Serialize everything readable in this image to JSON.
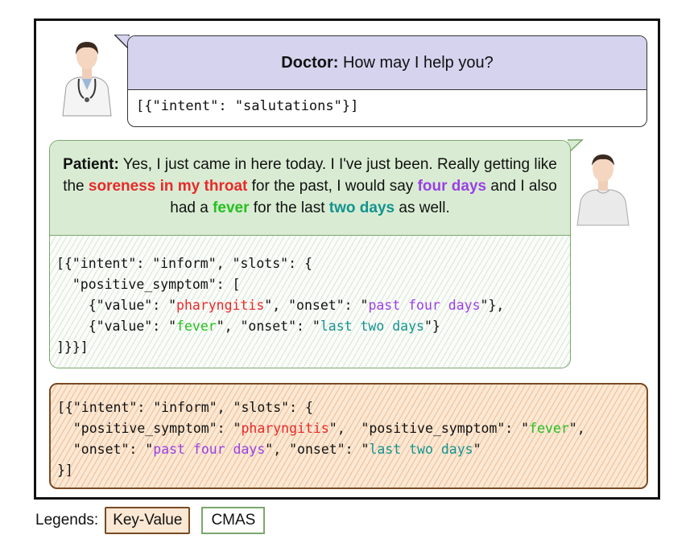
{
  "doctor": {
    "speaker": "Doctor:",
    "utterance": "How may I help you?",
    "annotation": "[{\"intent\": \"salutations\"}]"
  },
  "patient": {
    "speaker": "Patient:",
    "utterance": {
      "p1": "Yes, I just came in here today. I I've just been. Really getting like the",
      "h1": "soreness in my throat",
      "p2": "for the past, I would say",
      "h2": "four days",
      "p3": "and I also had a",
      "h3": "fever",
      "p4": "for the last",
      "h4": "two days",
      "p5": "as well."
    },
    "annotation": {
      "l1": "[{\"intent\": \"inform\", \"slots\": {",
      "l2": "  \"positive_symptom\": [",
      "l3a": "    {\"value\": \"",
      "l3v": "pharyngitis",
      "l3b": "\", \"onset\": \"",
      "l3o": "past four days",
      "l3c": "\"},",
      "l4a": "    {\"value\": \"",
      "l4v": "fever",
      "l4b": "\", \"onset\": \"",
      "l4o": "last two days",
      "l4c": "\"}",
      "l5": "]}}]"
    }
  },
  "key_value": {
    "l1": "[{\"intent\": \"inform\", \"slots\": {",
    "l2a": "  \"positive_symptom\": \"",
    "l2v1": "pharyngitis",
    "l2b": "\",  \"positive_symptom\": \"",
    "l2v2": "fever",
    "l2c": "\",",
    "l3a": "  \"onset\": \"",
    "l3o1": "past four days",
    "l3b": "\", \"onset\": \"",
    "l3o2": "last two days",
    "l3c": "\"",
    "l4": "}]"
  },
  "legend": {
    "label": "Legends:",
    "key_value": "Key-Value",
    "cmas": "CMAS"
  },
  "icons": [
    "doctor-avatar-icon",
    "patient-avatar-icon"
  ],
  "colors": {
    "doctor_bubble": "#d5d3ee",
    "patient_bubble": "#d9ecd3",
    "key_value_fill": "#fbe8d4",
    "highlight_red": "#e8292a",
    "highlight_purple": "#9a40e6",
    "highlight_green": "#25c020",
    "highlight_teal": "#13938f"
  }
}
